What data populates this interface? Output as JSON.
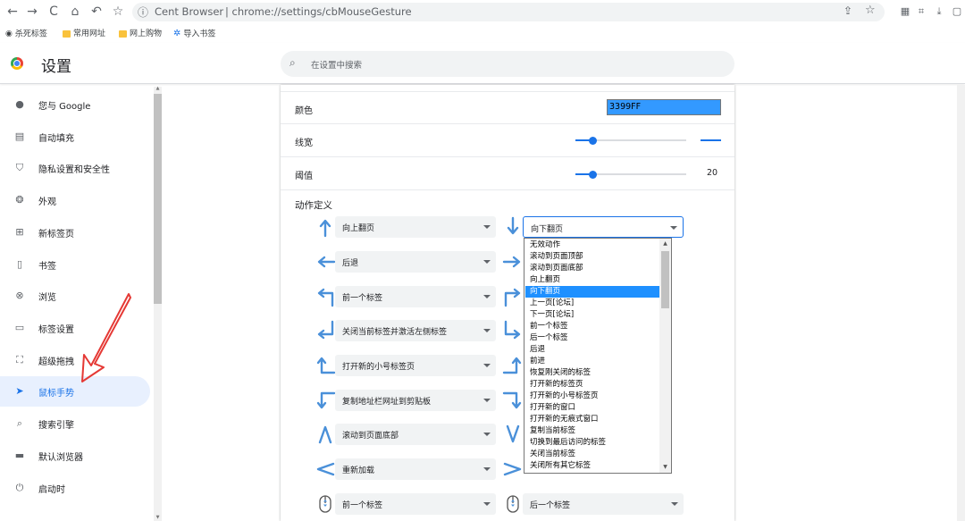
{
  "browser": {
    "brand": "Cent Browser",
    "url": "chrome://settings/cbMouseGesture",
    "nav": [
      "back-icon",
      "forward-icon",
      "reload-icon",
      "home-icon",
      "undo-icon",
      "bookmark-star-icon"
    ]
  },
  "bookmarks": [
    "杀死标签",
    "常用网址",
    "网上购物",
    "导入书签"
  ],
  "header": {
    "title": "设置",
    "search_placeholder": "在设置中搜索"
  },
  "sidebar": {
    "items": [
      {
        "label": "您与 Google",
        "icon": "person-icon"
      },
      {
        "label": "自动填充",
        "icon": "clipboard-icon"
      },
      {
        "label": "隐私设置和安全性",
        "icon": "shield-icon"
      },
      {
        "label": "外观",
        "icon": "palette-icon"
      },
      {
        "label": "新标签页",
        "icon": "new-tab-icon"
      },
      {
        "label": "书签",
        "icon": "bookmark-icon"
      },
      {
        "label": "浏览",
        "icon": "browse-icon"
      },
      {
        "label": "标签设置",
        "icon": "tab-icon"
      },
      {
        "label": "超级拖拽",
        "icon": "drag-icon"
      },
      {
        "label": "鼠标手势",
        "icon": "cursor-icon"
      },
      {
        "label": "搜索引擎",
        "icon": "search-icon"
      },
      {
        "label": "默认浏览器",
        "icon": "browser-icon"
      },
      {
        "label": "启动时",
        "icon": "power-icon"
      }
    ]
  },
  "settings": {
    "color_label": "颜色",
    "color_value": "3399FF",
    "width_label": "线宽",
    "width_slider": 0.15,
    "threshold_label": "阈值",
    "threshold_value": "20",
    "threshold_slider": 0.15,
    "actions_title": "动作定义"
  },
  "gestures": {
    "left": [
      {
        "icon": "arrow-up-icon",
        "action": "向上翻页"
      },
      {
        "icon": "arrow-left-icon",
        "action": "后退"
      },
      {
        "icon": "arrow-up-left-icon",
        "action": "前一个标签"
      },
      {
        "icon": "arrow-down-left-icon",
        "action": "关闭当前标签并激活左侧标签"
      },
      {
        "icon": "arrow-left-up-icon",
        "action": "打开新的小号标签页"
      },
      {
        "icon": "arrow-left-down-icon",
        "action": "复制地址栏网址到剪贴板"
      },
      {
        "icon": "arrow-caret-up-icon",
        "action": "滚动到页面底部"
      },
      {
        "icon": "arrow-caret-left-icon",
        "action": "重新加载"
      },
      {
        "icon": "mouse-wheel-icon",
        "action": "前一个标签"
      }
    ],
    "right": [
      {
        "icon": "arrow-down-icon",
        "action": "向下翻页"
      },
      {
        "icon": "arrow-right-icon",
        "action": ""
      },
      {
        "icon": "arrow-up-right-icon",
        "action": ""
      },
      {
        "icon": "arrow-down-right-icon",
        "action": ""
      },
      {
        "icon": "arrow-right-up-icon",
        "action": ""
      },
      {
        "icon": "arrow-right-down-icon",
        "action": ""
      },
      {
        "icon": "arrow-caret-down-icon",
        "action": ""
      },
      {
        "icon": "arrow-caret-right-icon",
        "action": ""
      },
      {
        "icon": "mouse-wheel-icon",
        "action": "后一个标签"
      }
    ]
  },
  "dropdown": {
    "selected": "向下翻页",
    "options": [
      "无效动作",
      "滚动到页面顶部",
      "滚动到页面底部",
      "向上翻页",
      "向下翻页",
      "上一页[论坛]",
      "下一页[论坛]",
      "前一个标签",
      "后一个标签",
      "后退",
      "前进",
      "恢复刚关闭的标签",
      "打开新的标签页",
      "打开新的小号标签页",
      "打开新的窗口",
      "打开新的无痕式窗口",
      "复制当前标签",
      "切换到最后访问的标签",
      "关闭当前标签",
      "关闭所有其它标签"
    ]
  }
}
